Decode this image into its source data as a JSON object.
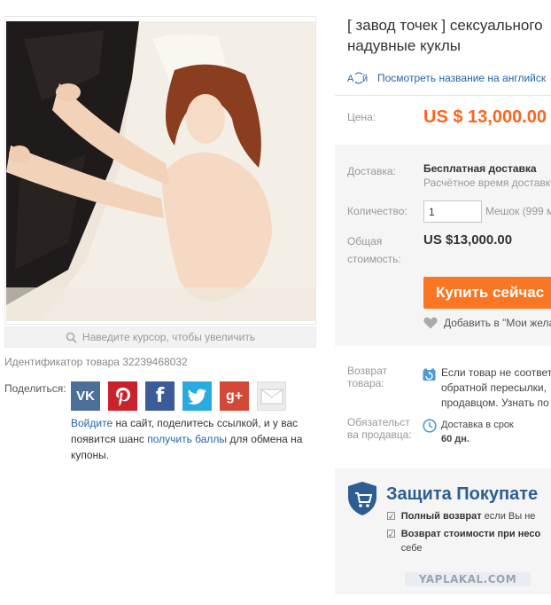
{
  "product": {
    "title_line1": "[ завод точек ] сексуального",
    "title_line2": "надувные куклы",
    "translate_link": "Посмотреть название на английск",
    "product_id": "Идентификатор товара 32239468032"
  },
  "gallery": {
    "zoom_hint": "Наведите курсор, чтобы увеличить"
  },
  "share": {
    "label": "Поделиться:",
    "networks": [
      "vk-icon",
      "pinterest-icon",
      "facebook-icon",
      "twitter-icon",
      "google-plus-icon",
      "email-icon"
    ],
    "vk_text": "VK",
    "fb_text": "f",
    "gp_text": "g+",
    "note_link_login": "Войдите",
    "note_part1": " на сайт, поделитесь ссылкой, и у вас появится шанс ",
    "note_link_points": "получить баллы",
    "note_part2": " для обмена на купоны."
  },
  "price": {
    "label": "Цена:",
    "value": "US $ 13,000.00"
  },
  "order": {
    "shipping_label": "Доставка:",
    "shipping_free": "Бесплатная доставка",
    "shipping_eta": "Расчётное время доставки",
    "quantity_label": "Количество:",
    "quantity_value": "1",
    "quantity_unit": "Мешок (999 м",
    "total_label": "Общая стоимость:",
    "total_value": "US $13,000.00",
    "buy_button": "Купить сейчас",
    "wishlist": "Добавить в \"Мои жела"
  },
  "policies": {
    "return_label": "Возврат товара:",
    "return_line1": "Если товар не соответ",
    "return_line2": "обратной пересылки,",
    "return_line3": "продавцом. Узнать по",
    "guarantee_label": "Обязательст ва продавца:",
    "guarantee_line1": "Доставка в срок",
    "guarantee_line2": "60 дн."
  },
  "protection": {
    "title": "Защита Покупате",
    "item1_bold": "Полный возврат",
    "item1_rest": " если Вы не",
    "item2_bold": "Возврат стоимости при несо",
    "item2_rest": "себе"
  },
  "watermark": "YAPLAKAL.COM",
  "colors": {
    "price": "#f9661e",
    "buy_button": "#f97622",
    "link": "#2465a8",
    "protection_title": "#2c5e93"
  }
}
